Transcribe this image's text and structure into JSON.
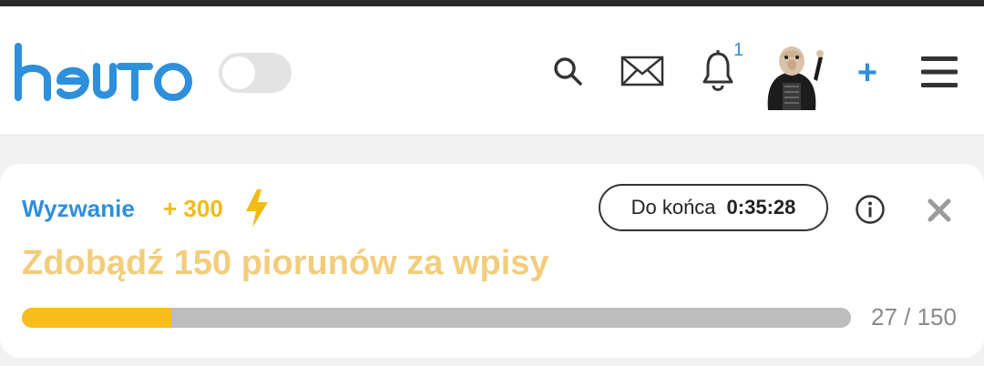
{
  "app": {
    "logo_text": "hejto",
    "brand_color": "#2e8fdc"
  },
  "header": {
    "theme_toggle": {
      "state": "off"
    },
    "icons": {
      "search": "search-icon",
      "messages": "mail-icon",
      "notifications": "bell-icon",
      "add": "plus-icon",
      "menu": "hamburger-menu-icon"
    },
    "notification_count": "1",
    "add_label": "+"
  },
  "challenge": {
    "label": "Wyzwanie",
    "points": "+ 300",
    "points_icon": "lightning-bolt-icon",
    "timer_label": "Do końca",
    "timer_value": "0:35:28",
    "title": "Zdobądź 150 piorunów za wpisy",
    "progress_text": "27 / 150",
    "progress": {
      "current": 27,
      "total": 150
    },
    "accent_color": "#f2bb15",
    "progress_color": "#f8bd1a"
  }
}
